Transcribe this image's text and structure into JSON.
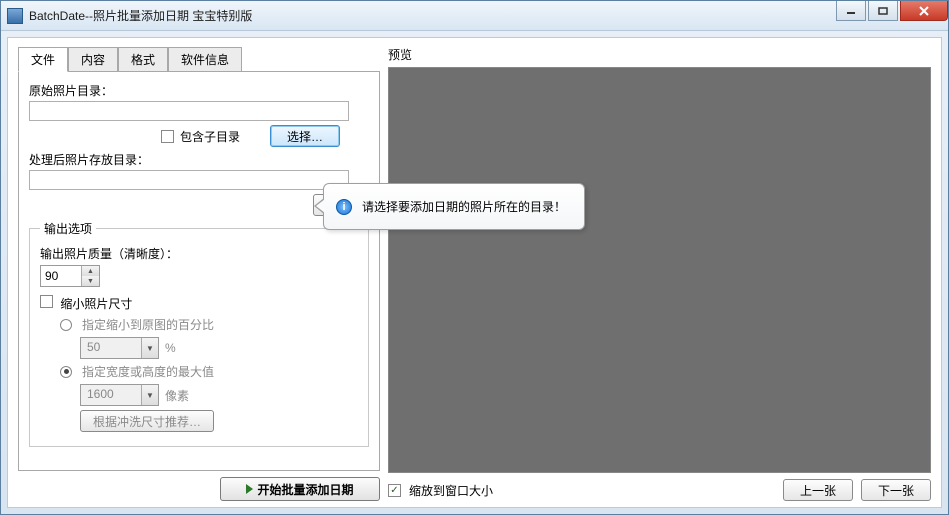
{
  "window": {
    "title": "BatchDate--照片批量添加日期 宝宝特别版"
  },
  "tabs": {
    "file": "文件",
    "content": "内容",
    "format": "格式",
    "about": "软件信息"
  },
  "labels": {
    "src_dir": "原始照片目录：",
    "include_sub": "包含子目录",
    "select1": "选择…",
    "out_dir": "处理后照片存放目录：",
    "select2": "选择…",
    "output_group": "输出选项",
    "quality": "输出照片质量（清晰度）：",
    "shrink": "缩小照片尺寸",
    "percent": "指定缩小到原图的百分比",
    "percent_unit": "%",
    "maxdim": "指定宽度或高度的最大值",
    "maxdim_unit": "像素",
    "recommend": "根据冲洗尺寸推荐…",
    "start": "开始批量添加日期",
    "preview": "预览",
    "fit_window": "缩放到窗口大小",
    "prev": "上一张",
    "next": "下一张"
  },
  "values": {
    "src_dir": "",
    "out_dir": "",
    "quality": "90",
    "percent": "50",
    "maxdim": "1600",
    "include_sub_checked": false,
    "shrink_checked": false,
    "resize_mode": "maxdim",
    "fit_window_checked": true
  },
  "tooltip": {
    "text": "请选择要添加日期的照片所在的目录！"
  }
}
